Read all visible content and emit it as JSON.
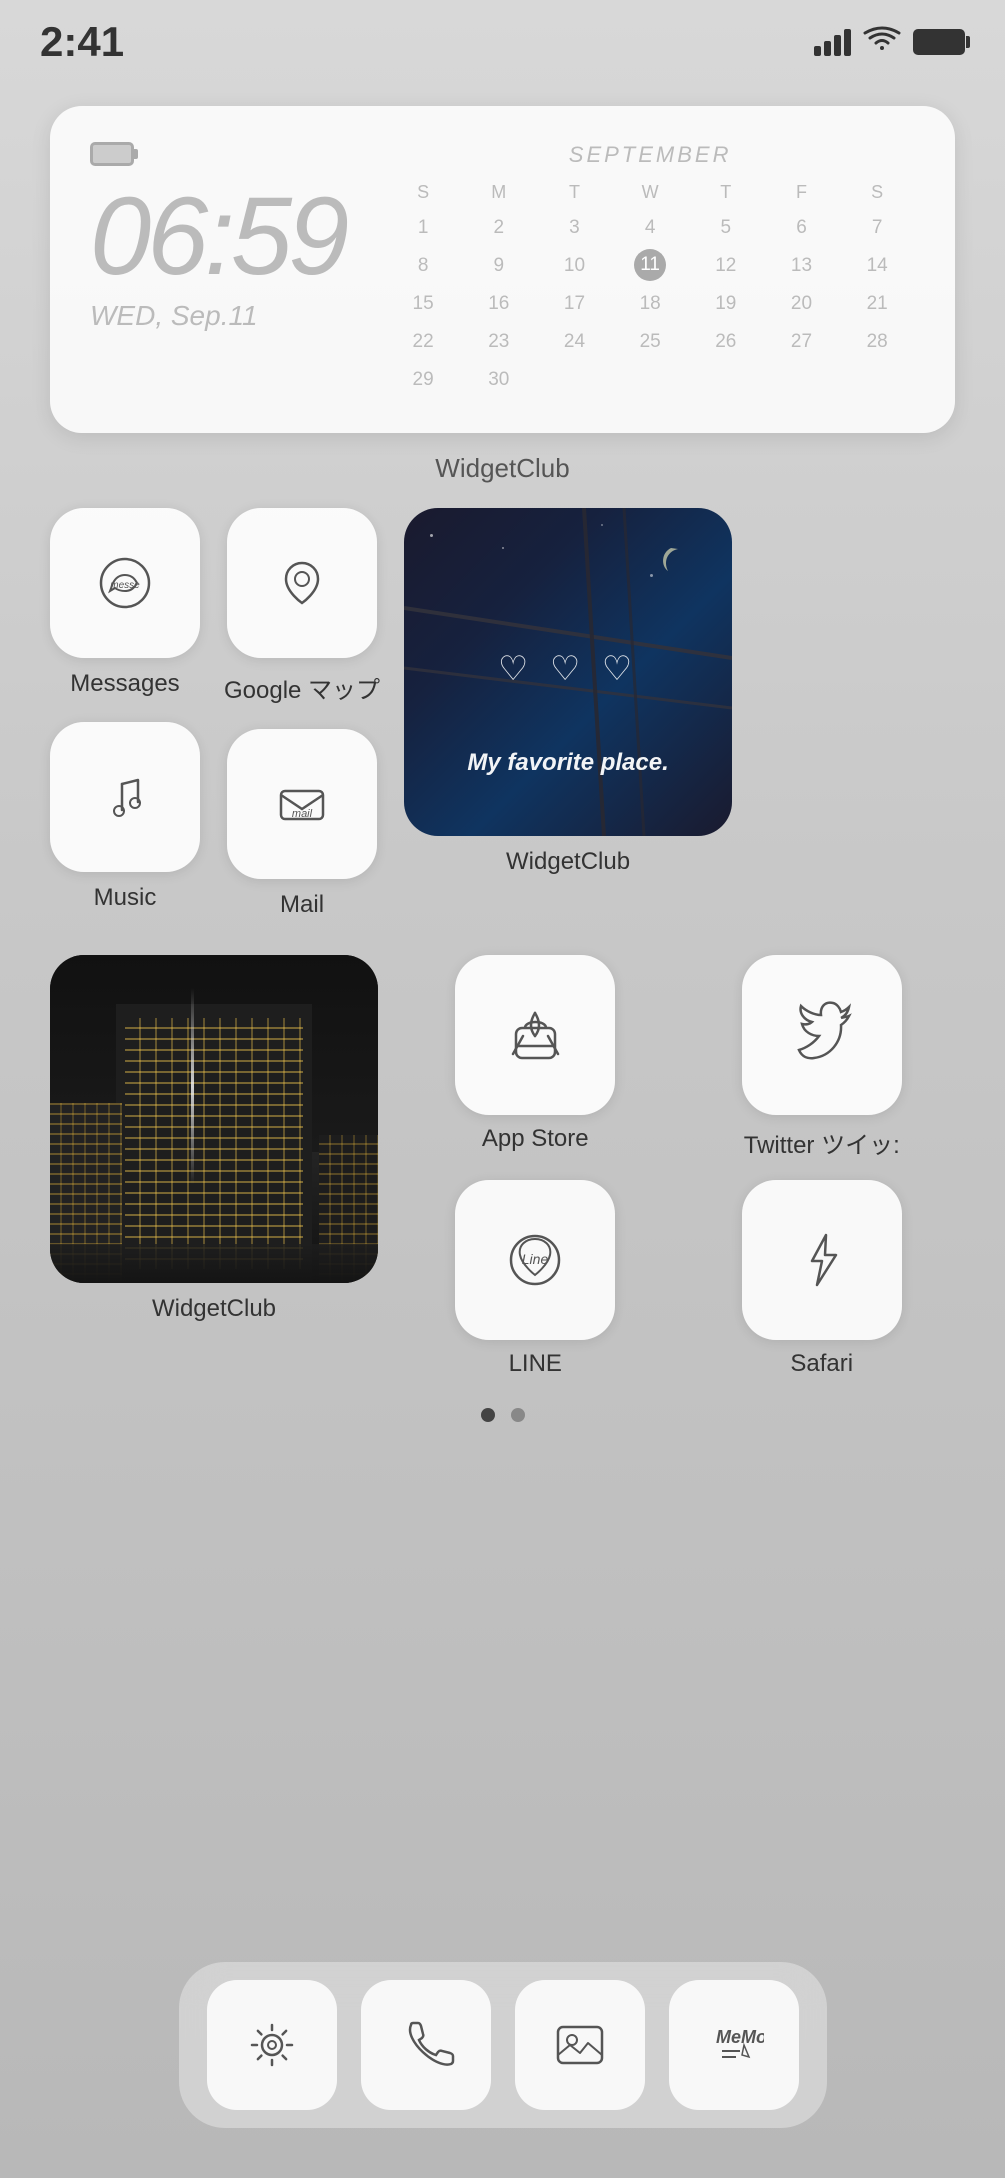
{
  "statusBar": {
    "time": "2:41"
  },
  "clockWidget": {
    "time": "06:59",
    "date": "WED, Sep.11",
    "widgetClubLabel": "WidgetClub"
  },
  "calendar": {
    "month": "SEPTEMBER",
    "headers": [
      "S",
      "M",
      "T",
      "W",
      "T",
      "F",
      "S"
    ],
    "weeks": [
      [
        "1",
        "2",
        "3",
        "4",
        "5",
        "6",
        "7"
      ],
      [
        "8",
        "9",
        "10",
        "11",
        "12",
        "13",
        "14"
      ],
      [
        "15",
        "16",
        "17",
        "18",
        "19",
        "20",
        "21"
      ],
      [
        "22",
        "23",
        "24",
        "25",
        "26",
        "27",
        "28"
      ],
      [
        "29",
        "30",
        "",
        "",
        "",
        "",
        ""
      ]
    ],
    "today": "11"
  },
  "apps": {
    "row1": [
      {
        "label": "Messages",
        "icon": "messages"
      },
      {
        "label": "Music",
        "icon": "music"
      }
    ],
    "row2": [
      {
        "label": "Google マップ",
        "icon": "maps"
      },
      {
        "label": "Mail",
        "icon": "mail"
      }
    ],
    "widgetPhotoLabel": "WidgetClub",
    "widgetCityLabel": "WidgetClub",
    "rightApps": [
      {
        "label": "App Store",
        "icon": "appstore"
      },
      {
        "label": "Twitter ツイッ:",
        "icon": "twitter"
      },
      {
        "label": "LINE",
        "icon": "line"
      },
      {
        "label": "Safari",
        "icon": "safari"
      }
    ]
  },
  "favoriteWidget": {
    "hearts": "♡ ♡ ♡",
    "text": "My favorite place."
  },
  "dock": [
    {
      "label": "Settings",
      "icon": "settings"
    },
    {
      "label": "Phone",
      "icon": "phone"
    },
    {
      "label": "Photos",
      "icon": "photos"
    },
    {
      "label": "Memo",
      "icon": "memo"
    }
  ],
  "pageDots": {
    "active": 0,
    "total": 2
  }
}
